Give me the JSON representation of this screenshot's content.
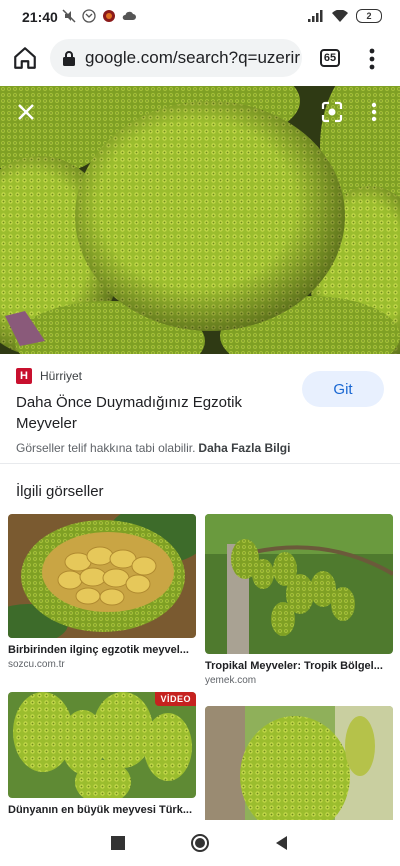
{
  "status": {
    "time": "21:40",
    "battery": "2"
  },
  "browser": {
    "url": "google.com/search?q=uzerir",
    "tab_count": "65"
  },
  "result": {
    "source_name": "Hürriyet",
    "source_letter": "H",
    "title": "Daha Önce Duymadığınız Egzotik Meyveler",
    "go_label": "Git",
    "copyright_text": "Görseller telif hakkına tabi olabilir.",
    "more_info": "Daha Fazla Bilgi"
  },
  "related": {
    "heading": "İlgili görseller",
    "items": [
      {
        "caption": "Birbirinden ilginç egzotik meyvel...",
        "domain": "sozcu.com.tr"
      },
      {
        "caption": "Tropikal Meyveler: Tropik Bölgel...",
        "domain": "yemek.com"
      },
      {
        "caption": "Dünyanın en büyük meyvesi Türk...",
        "badge": "VİDEO"
      },
      {
        "caption": ""
      }
    ]
  },
  "colors": {
    "accent": "#1967d2",
    "go_bg": "#e8f0fe",
    "badge": "#c5221f"
  }
}
